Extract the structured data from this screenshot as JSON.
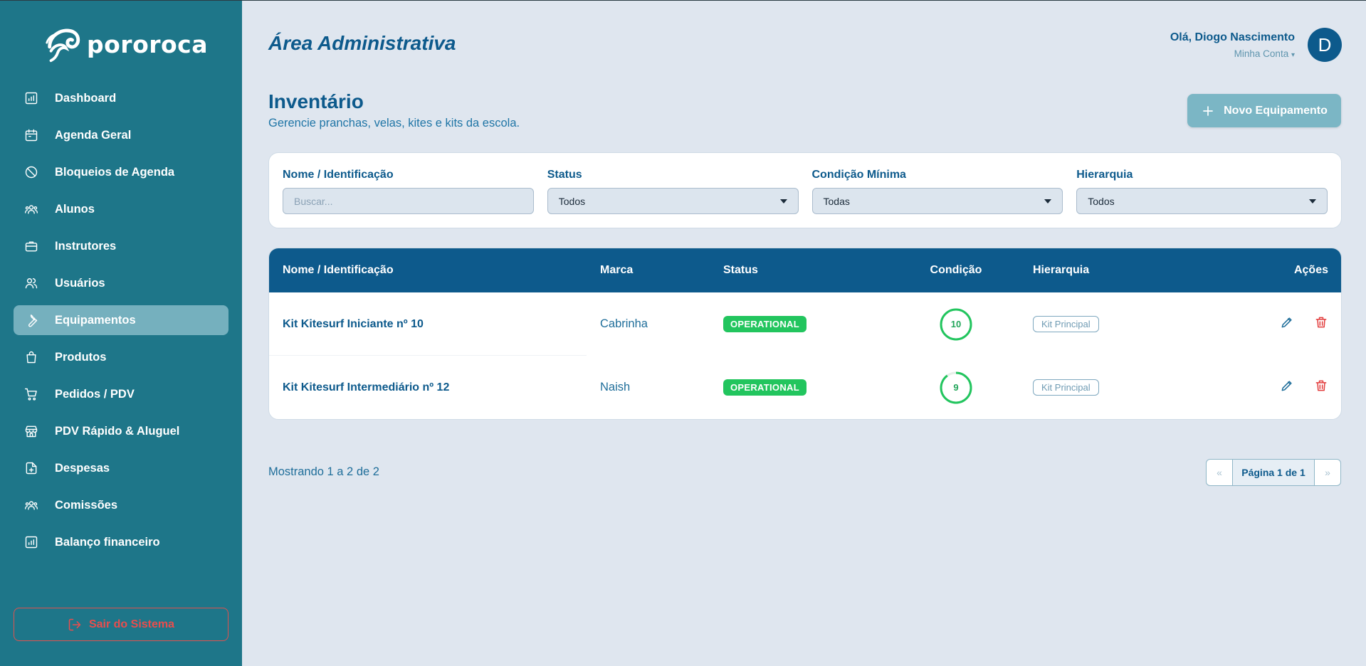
{
  "brand": {
    "name": "pororoca",
    "icon": "wave-logo-icon"
  },
  "sidebar": {
    "items": [
      {
        "label": "Dashboard",
        "icon": "bar-chart-icon",
        "active": false
      },
      {
        "label": "Agenda Geral",
        "icon": "calendar-icon",
        "active": false
      },
      {
        "label": "Bloqueios de Agenda",
        "icon": "ban-icon",
        "active": false
      },
      {
        "label": "Alunos",
        "icon": "users-group-icon",
        "active": false
      },
      {
        "label": "Instrutores",
        "icon": "briefcase-icon",
        "active": false
      },
      {
        "label": "Usuários",
        "icon": "users-icon",
        "active": false
      },
      {
        "label": "Equipamentos",
        "icon": "wrench-icon",
        "active": true
      },
      {
        "label": "Produtos",
        "icon": "shopping-bag-icon",
        "active": false
      },
      {
        "label": "Pedidos / PDV",
        "icon": "cart-icon",
        "active": false
      },
      {
        "label": "PDV Rápido & Aluguel",
        "icon": "store-icon",
        "active": false
      },
      {
        "label": "Despesas",
        "icon": "file-plus-icon",
        "active": false
      },
      {
        "label": "Comissões",
        "icon": "users-group-icon",
        "active": false
      },
      {
        "label": "Balanço financeiro",
        "icon": "bar-chart-icon",
        "active": false
      }
    ],
    "logout_label": "Sair do Sistema"
  },
  "header": {
    "area_title": "Área Administrativa",
    "greeting": "Olá, Diogo Nascimento",
    "account_label": "Minha Conta",
    "account_caret": "▾",
    "avatar_initial": "D"
  },
  "page": {
    "title": "Inventário",
    "subtitle": "Gerencie pranchas, velas, kites e kits da escola.",
    "new_button_label": "Novo Equipamento"
  },
  "filters": [
    {
      "label": "Nome / Identificação",
      "type": "input",
      "placeholder": "Buscar...",
      "value": ""
    },
    {
      "label": "Status",
      "type": "select",
      "value": "Todos"
    },
    {
      "label": "Condição Mínima",
      "type": "select",
      "value": "Todas"
    },
    {
      "label": "Hierarquia",
      "type": "select",
      "value": "Todos"
    }
  ],
  "table": {
    "headers": [
      "Nome / Identificação",
      "Marca",
      "Status",
      "Condição",
      "Hierarquia",
      "Ações"
    ],
    "rows": [
      {
        "name": "Kit Kitesurf Iniciante nº 10",
        "brand": "Cabrinha",
        "status": "OPERATIONAL",
        "condition": "10",
        "condition_fraction": 1.0,
        "hierarchy": "Kit Principal"
      },
      {
        "name": "Kit Kitesurf Intermediário nº 12",
        "brand": "Naish",
        "status": "OPERATIONAL",
        "condition": "9",
        "condition_fraction": 0.9,
        "hierarchy": "Kit Principal"
      }
    ]
  },
  "footer": {
    "showing": "Mostrando 1 a 2 de 2",
    "prev": "«",
    "page_label": "Página 1 de 1",
    "next": "»"
  },
  "colors": {
    "sidebar": "#1e7689",
    "primary": "#0d5a8c",
    "success": "#22c55e",
    "danger": "#e23b3b",
    "background": "#dfe6ef"
  }
}
